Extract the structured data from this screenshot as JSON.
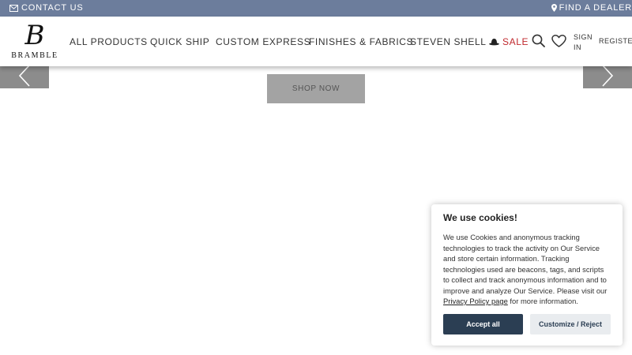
{
  "topbar": {
    "contact_label": "CONTACT US",
    "contact_icon": "envelope-icon",
    "dealer_label": "FIND A DEALER",
    "dealer_icon": "map-pin-icon",
    "background": "#6c7d9c"
  },
  "header": {
    "logo_monogram": "B",
    "logo_word": "BRAMBLE",
    "nav": [
      {
        "label": "ALL PRODUCTS"
      },
      {
        "label": "QUICK SHIP"
      },
      {
        "label": "CUSTOM EXPRESS"
      },
      {
        "label": "FINISHES & FABRICS"
      },
      {
        "label": "STEVEN SHELL",
        "icon": "bowler-hat-icon"
      },
      {
        "label": "SALE",
        "color": "#c0282d"
      }
    ],
    "search_icon": "search-icon",
    "wishlist_icon": "heart-icon",
    "sign_in_label": "SIGN IN",
    "register_label": "REGISTER"
  },
  "hero": {
    "shop_now_label": "SHOP NOW",
    "prev_icon": "chevron-left-icon",
    "next_icon": "chevron-right-icon"
  },
  "cookie_banner": {
    "title": "We use cookies!",
    "body_before_link": "We use Cookies and anonymous tracking technologies to track the activity on Our Service and store certain information. Tracking technologies used are beacons, tags, and scripts to collect and track anonymous information and to improve and analyze Our Service. Please visit our ",
    "policy_link": "Privacy Policy page",
    "body_after_link": " for more information.",
    "accept_label": "Accept all",
    "customize_label": "Customize / Reject",
    "accent": "#2b3e53"
  }
}
